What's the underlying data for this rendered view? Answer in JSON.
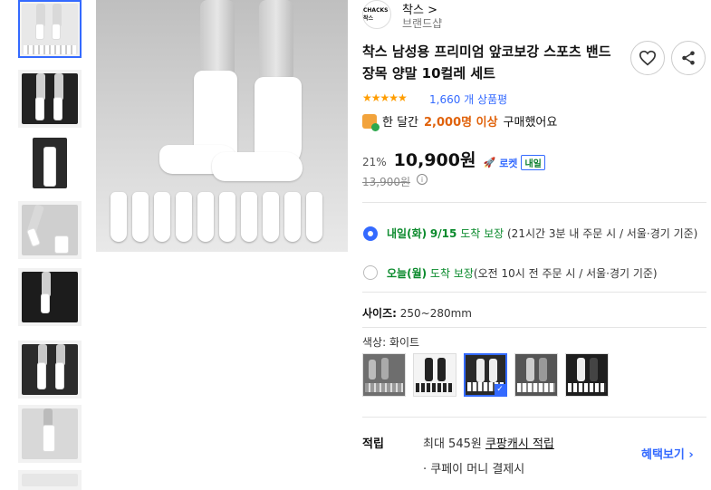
{
  "brand": {
    "name": "착스",
    "sub": "브랜드샵",
    "logo_text": "CHACKS 착스"
  },
  "product": {
    "title": "착스 남성용 프리미엄 앞코보강 스포츠 밴드 장목 양말 10컬레 세트",
    "stars": "★★★★★",
    "review_count": "1,660 개 상품평",
    "bought_prefix": "한 달간",
    "bought_highlight": "2,000명 이상",
    "bought_suffix": "구매했어요",
    "discount": "21%",
    "price": "10,900원",
    "rocket_label": "로켓",
    "naeil_badge": "내일",
    "original_price": "13,900원"
  },
  "delivery": [
    {
      "selected": true,
      "day": "내일(화)",
      "date": "9/15",
      "label": "도착 보장",
      "detail": "(21시간 3분 내 주문 시 / 서울·경기 기준)"
    },
    {
      "selected": false,
      "day": "오늘(월)",
      "date": "",
      "label": "도착 보장",
      "detail": "(오전 10시 전 주문 시 / 서울·경기 기준)"
    }
  ],
  "options": {
    "size_label": "사이즈:",
    "size_value": "250~280mm",
    "color_label": "색상:",
    "color_value": "화이트",
    "swatches": [
      "gray",
      "black",
      "white",
      "mixed-gray",
      "mixed-black"
    ]
  },
  "reward": {
    "title": "적립",
    "line1_prefix": "최대 545원",
    "line1_link": "쿠팡캐시 적립",
    "line2": "· 쿠페이 머니 결제시",
    "benefit": "혜택보기 ›"
  },
  "colors": {
    "accent": "#346aff",
    "star": "#ff9d00",
    "green": "#0a8a2c",
    "orange": "#e0620b"
  }
}
